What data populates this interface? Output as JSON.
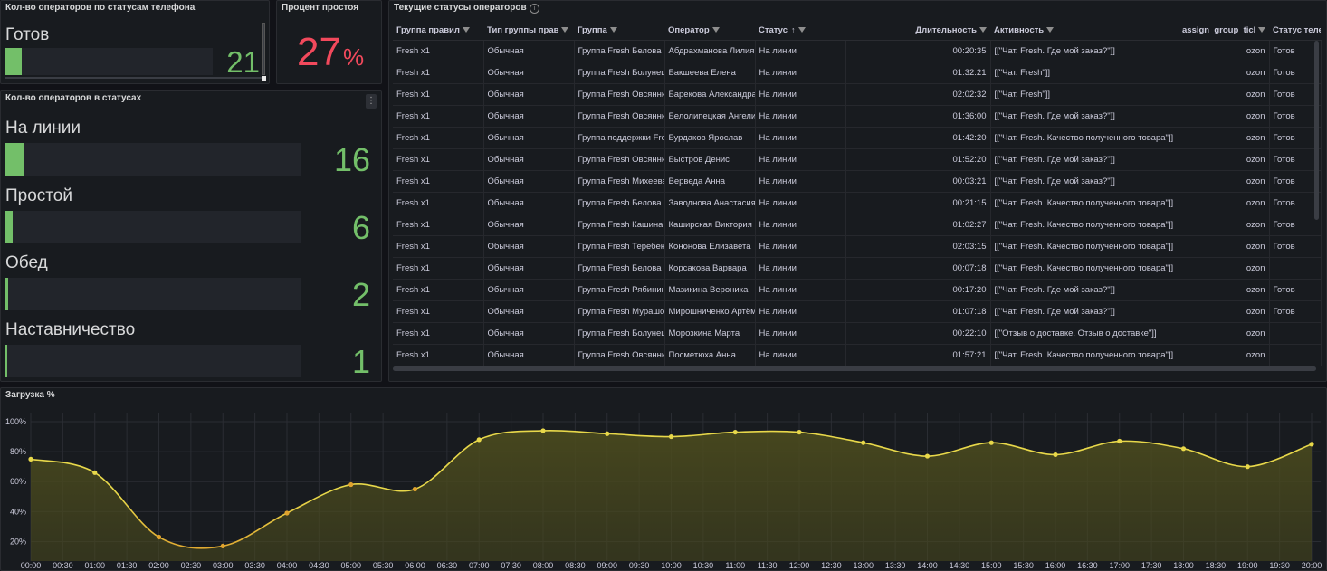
{
  "panel_ready": {
    "title": "Кол-во операторов по статусам телефона",
    "label": "Готов",
    "value": "21",
    "fill_fraction": 0.08
  },
  "panel_idle": {
    "title": "Процент простоя",
    "value": "27",
    "unit": "%"
  },
  "panel_statuses": {
    "title": "Кол-во операторов в статусах",
    "menu_icon": "more-vertical-icon",
    "items": [
      {
        "label": "На линии",
        "value": "16",
        "fill_fraction": 0.06
      },
      {
        "label": "Простой",
        "value": "6",
        "fill_fraction": 0.025
      },
      {
        "label": "Обед",
        "value": "2",
        "fill_fraction": 0.009
      },
      {
        "label": "Наставничество",
        "value": "1",
        "fill_fraction": 0.004
      }
    ]
  },
  "panel_table": {
    "title": "Текущие статусы операторов",
    "info_icon": "info-icon",
    "columns": [
      "Группа правил",
      "Тип группы прав",
      "Группа",
      "Оператор",
      "Статус",
      "Длительность",
      "Активность",
      "assign_group_ticl",
      "Статус телефона"
    ],
    "rows": [
      [
        "Fresh x1",
        "Обычная",
        "Группа Fresh Белова",
        "Абдрахманова Лилия",
        "На линии",
        "00:20:35",
        "[[\"Чат. Fresh. Где мой заказ?\"]]",
        "ozon",
        "Готов"
      ],
      [
        "Fresh x1",
        "Обычная",
        "Группа Fresh Болунец",
        "Бакшеева Елена",
        "На линии",
        "01:32:21",
        "[[\"Чат. Fresh\"]]",
        "ozon",
        "Готов"
      ],
      [
        "Fresh x1",
        "Обычная",
        "Группа Fresh Овсянникова",
        "Барекова Александра",
        "На линии",
        "02:02:32",
        "[[\"Чат. Fresh\"]]",
        "ozon",
        "Готов"
      ],
      [
        "Fresh x1",
        "Обычная",
        "Группа Fresh Овсянникова",
        "Белолипецкая Ангелина",
        "На линии",
        "01:36:00",
        "[[\"Чат. Fresh. Где мой заказ?\"]]",
        "ozon",
        "Готов"
      ],
      [
        "Fresh x1",
        "Обычная",
        "Группа поддержки Fresh",
        "Бурдаков Ярослав",
        "На линии",
        "01:42:20",
        "[[\"Чат. Fresh. Качество полученного товара\"]]",
        "ozon",
        "Готов"
      ],
      [
        "Fresh x1",
        "Обычная",
        "Группа Fresh Овсянникова",
        "Быстров Денис",
        "На линии",
        "01:52:20",
        "[[\"Чат. Fresh. Где мой заказ?\"]]",
        "ozon",
        "Готов"
      ],
      [
        "Fresh x1",
        "Обычная",
        "Группа Fresh Михеева",
        "Верведа Анна",
        "На линии",
        "00:03:21",
        "[[\"Чат. Fresh. Где мой заказ?\"]]",
        "ozon",
        "Готов"
      ],
      [
        "Fresh x1",
        "Обычная",
        "Группа Fresh Белова",
        "Заводнова Анастасия",
        "На линии",
        "00:21:15",
        "[[\"Чат. Fresh. Качество полученного товара\"]]",
        "ozon",
        "Готов"
      ],
      [
        "Fresh x1",
        "Обычная",
        "Группа Fresh Кашина",
        "Каширская Виктория",
        "На линии",
        "01:02:27",
        "[[\"Чат. Fresh. Качество полученного товара\"]]",
        "ozon",
        "Готов"
      ],
      [
        "Fresh x1",
        "Обычная",
        "Группа Fresh Теребенина",
        "Кононова Елизавета",
        "На линии",
        "02:03:15",
        "[[\"Чат. Fresh. Качество полученного товара\"]]",
        "ozon",
        "Готов"
      ],
      [
        "Fresh x1",
        "Обычная",
        "Группа Fresh Белова",
        "Корсакова Варвара",
        "На линии",
        "00:07:18",
        "[[\"Чат. Fresh. Качество полученного товара\"]]",
        "ozon",
        ""
      ],
      [
        "Fresh x1",
        "Обычная",
        "Группа Fresh Рябинина",
        "Мазикина Вероника",
        "На линии",
        "00:17:20",
        "[[\"Чат. Fresh. Где мой заказ?\"]]",
        "ozon",
        "Готов"
      ],
      [
        "Fresh x1",
        "Обычная",
        "Группа Fresh Мурашова",
        "Мирошниченко Артём",
        "На линии",
        "01:07:18",
        "[[\"Чат. Fresh. Где мой заказ?\"]]",
        "ozon",
        "Готов"
      ],
      [
        "Fresh x1",
        "Обычная",
        "Группа Fresh Болунец",
        "Морозкина Марта",
        "На линии",
        "00:22:10",
        "[[\"Отзыв о доставке. Отзыв о доставке\"]]",
        "ozon",
        ""
      ],
      [
        "Fresh x1",
        "Обычная",
        "Группа Fresh Овсянникова",
        "Посметюха Анна",
        "На линии",
        "01:57:21",
        "[[\"Чат. Fresh. Качество полученного товара\"]]",
        "ozon",
        ""
      ]
    ]
  },
  "panel_chart": {
    "title": "Загрузка %",
    "colors": {
      "line": "#e8d84a",
      "line_low": "#e0a32e",
      "fill": "#4a4a1e",
      "grid": "#2a2d33"
    }
  },
  "chart_data": {
    "type": "line",
    "title": "Загрузка %",
    "x": [
      "00:00",
      "00:30",
      "01:00",
      "01:30",
      "02:00",
      "02:30",
      "03:00",
      "03:30",
      "04:00",
      "04:30",
      "05:00",
      "05:30",
      "06:00",
      "06:30",
      "07:00",
      "07:30",
      "08:00",
      "08:30",
      "09:00",
      "09:30",
      "10:00",
      "10:30",
      "11:00",
      "11:30",
      "12:00",
      "12:30",
      "13:00",
      "13:30",
      "14:00",
      "14:30",
      "15:00",
      "15:30",
      "16:00",
      "16:30",
      "17:00",
      "17:30",
      "18:00",
      "18:30",
      "19:00",
      "19:30",
      "20:00"
    ],
    "points": [
      {
        "x": "00:00",
        "y": 75
      },
      {
        "x": "01:00",
        "y": 66
      },
      {
        "x": "02:00",
        "y": 23
      },
      {
        "x": "03:00",
        "y": 17
      },
      {
        "x": "04:00",
        "y": 39
      },
      {
        "x": "05:00",
        "y": 58
      },
      {
        "x": "06:00",
        "y": 55
      },
      {
        "x": "07:00",
        "y": 88
      },
      {
        "x": "08:00",
        "y": 94
      },
      {
        "x": "09:00",
        "y": 92
      },
      {
        "x": "10:00",
        "y": 90
      },
      {
        "x": "11:00",
        "y": 93
      },
      {
        "x": "12:00",
        "y": 93
      },
      {
        "x": "13:00",
        "y": 86
      },
      {
        "x": "14:00",
        "y": 77
      },
      {
        "x": "15:00",
        "y": 86
      },
      {
        "x": "16:00",
        "y": 78
      },
      {
        "x": "17:00",
        "y": 87
      },
      {
        "x": "18:00",
        "y": 82
      },
      {
        "x": "19:00",
        "y": 70
      },
      {
        "x": "20:00",
        "y": 85
      }
    ],
    "y_ticks": [
      "20%",
      "40%",
      "60%",
      "80%",
      "100%"
    ],
    "ylim": [
      10,
      100
    ],
    "grid": true
  }
}
